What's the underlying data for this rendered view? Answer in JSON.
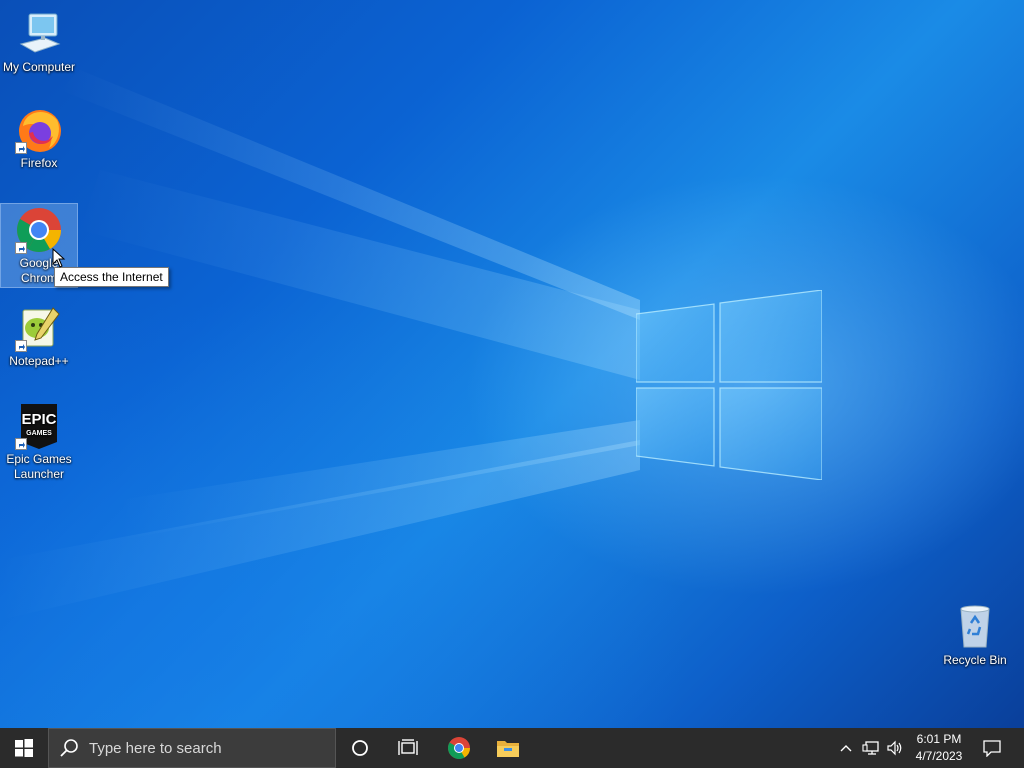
{
  "desktop": {
    "icons": [
      {
        "label": "My Computer",
        "icon": "computer-icon"
      },
      {
        "label": "Firefox",
        "icon": "firefox-icon"
      },
      {
        "label": "Google Chrome",
        "label_line1": "Google",
        "label_line2": "Chrom",
        "icon": "chrome-icon",
        "selected": true
      },
      {
        "label": "Notepad++",
        "icon": "notepadpp-icon"
      },
      {
        "label": "Epic Games Launcher",
        "label_line1": "Epic Games",
        "label_line2": "Launcher",
        "icon": "epic-games-icon",
        "logo_text_top": "EPIC",
        "logo_text_bottom": "GAMES"
      },
      {
        "label": "Recycle Bin",
        "icon": "recycle-bin-icon"
      }
    ],
    "tooltip": "Access the Internet"
  },
  "taskbar": {
    "start_icon": "windows-start-icon",
    "search_placeholder": "Type here to search",
    "cortana_icon": "cortana-circle-icon",
    "task_view_icon": "task-view-icon",
    "pinned": [
      {
        "name": "Google Chrome",
        "icon": "chrome-icon",
        "active": false
      },
      {
        "name": "File Explorer",
        "icon": "file-explorer-icon",
        "active": false
      }
    ],
    "tray": {
      "chevron_icon": "chevron-up-icon",
      "network_icon": "network-icon",
      "volume_icon": "volume-icon",
      "time": "6:01 PM",
      "date": "4/7/2023",
      "notification_icon": "action-center-icon"
    }
  },
  "colors": {
    "taskbar_bg": "#2b2b2b",
    "desktop_accent": "#0b63d3"
  }
}
